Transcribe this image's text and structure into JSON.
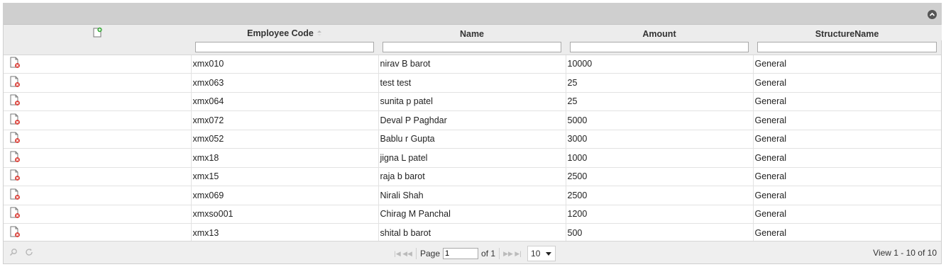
{
  "grid": {
    "header": {
      "columns": [
        "Employee Code",
        "Name",
        "Amount",
        "StructureName"
      ]
    },
    "rows": [
      {
        "code": "xmx010",
        "name": "nirav B barot",
        "amount": "10000",
        "structure": "General"
      },
      {
        "code": "xmx063",
        "name": "test test",
        "amount": "25",
        "structure": "General"
      },
      {
        "code": "xmx064",
        "name": "sunita p patel",
        "amount": "25",
        "structure": "General"
      },
      {
        "code": "xmx072",
        "name": "Deval P Paghdar",
        "amount": "5000",
        "structure": "General"
      },
      {
        "code": "xmx052",
        "name": "Bablu r Gupta",
        "amount": "3000",
        "structure": "General"
      },
      {
        "code": "xmx18",
        "name": "jigna L patel",
        "amount": "1000",
        "structure": "General"
      },
      {
        "code": "xmx15",
        "name": "raja b barot",
        "amount": "2500",
        "structure": "General"
      },
      {
        "code": "xmx069",
        "name": "Nirali Shah",
        "amount": "2500",
        "structure": "General"
      },
      {
        "code": "xmxso001",
        "name": "Chirag M Panchal",
        "amount": "1200",
        "structure": "General"
      },
      {
        "code": "xmx13",
        "name": "shital b barot",
        "amount": "500",
        "structure": "General"
      }
    ],
    "pager": {
      "page_label": "Page",
      "page_value": "1",
      "of_label": "of 1",
      "rows_per_page": "10",
      "view_info": "View 1 - 10 of 10"
    },
    "icons": {
      "add": "add-record-icon",
      "delete": "delete-record-icon",
      "search": "search-icon",
      "refresh": "refresh-icon",
      "collapse": "collapse-icon"
    }
  }
}
